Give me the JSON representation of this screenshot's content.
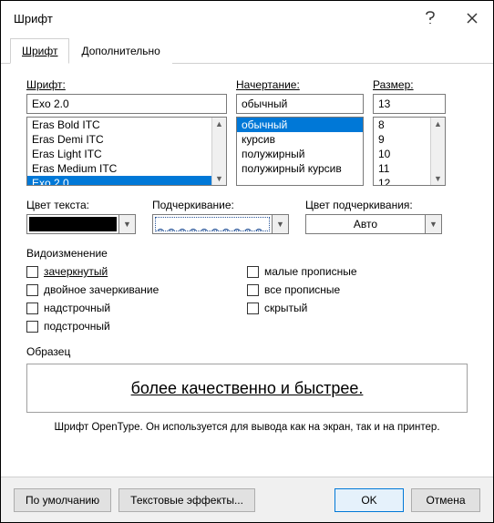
{
  "window": {
    "title": "Шрифт"
  },
  "tabs": {
    "font": "Шрифт",
    "advanced": "Дополнительно"
  },
  "labels": {
    "font": "Шрифт:",
    "style": "Начертание:",
    "size": "Размер:",
    "textColor": "Цвет текста:",
    "underline": "Подчеркивание:",
    "underlineColor": "Цвет подчеркивания:",
    "effects": "Видоизменение",
    "sample": "Образец"
  },
  "fontInput": "Exo 2.0",
  "fontList": [
    "Eras Bold ITC",
    "Eras Demi ITC",
    "Eras Light ITC",
    "Eras Medium ITC",
    "Exo 2.0"
  ],
  "fontSelectedIndex": 4,
  "styleInput": "обычный",
  "styleList": [
    "обычный",
    "курсив",
    "полужирный",
    "полужирный курсив"
  ],
  "styleSelectedIndex": 0,
  "sizeInput": "13",
  "sizeList": [
    "8",
    "9",
    "10",
    "11",
    "12"
  ],
  "underlineColorValue": "Авто",
  "effectsLeft": {
    "strike": "зачеркнутый",
    "dstrike": "двойное зачеркивание",
    "super": "надстрочный",
    "sub": "подстрочный"
  },
  "effectsRight": {
    "smallcaps": "малые прописные",
    "allcaps": "все прописные",
    "hidden": "скрытый"
  },
  "previewText": "более качественно и быстрее.",
  "hint": "Шрифт OpenType. Он используется для вывода как на экран, так и на принтер.",
  "buttons": {
    "default": "По умолчанию",
    "textEffects": "Текстовые эффекты...",
    "ok": "OK",
    "cancel": "Отмена"
  }
}
